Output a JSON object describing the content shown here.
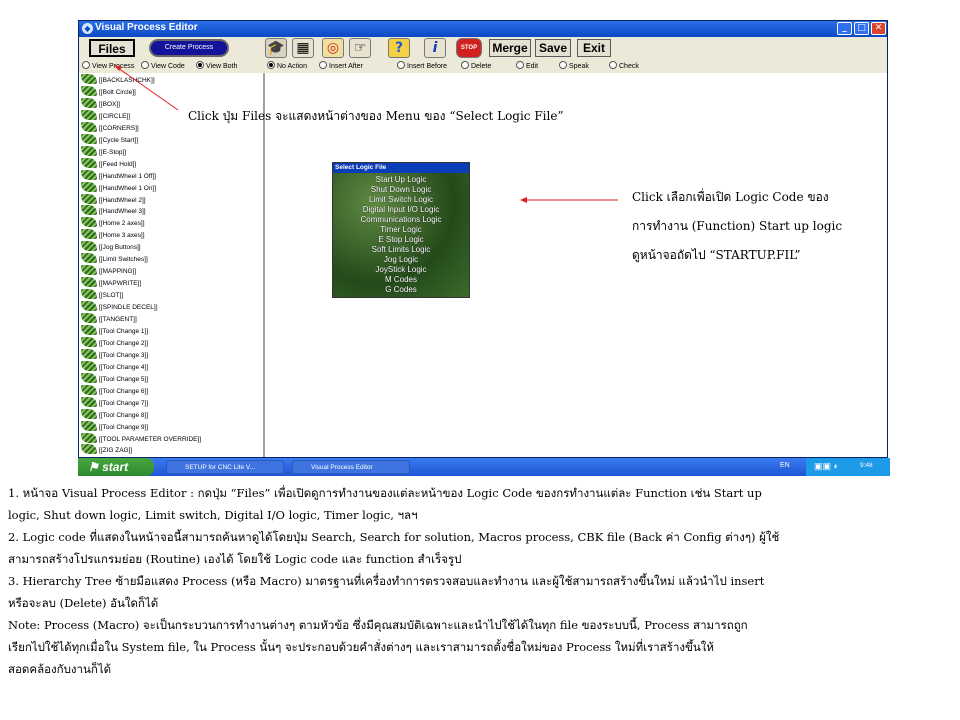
{
  "window": {
    "title": "Visual Process Editor",
    "controls": {
      "minimize": "_",
      "maximize": "□",
      "close": "✕"
    }
  },
  "toolbar": {
    "files": "Files",
    "create_process": "Create Process",
    "merge": "Merge",
    "save": "Save",
    "exit": "Exit",
    "icons": [
      "hat-icon",
      "grid-icon",
      "target-icon",
      "hand-icon",
      "help-icon",
      "info-icon",
      "stop-icon"
    ],
    "stop_label": "STOP"
  },
  "view_options": [
    "View Process",
    "View Code",
    "View Both"
  ],
  "view_selected": "View Both",
  "action_options": [
    "No Action",
    "Insert After",
    "Insert Before",
    "Delete",
    "Edit",
    "Speak",
    "Check"
  ],
  "action_selected": "No Action",
  "tree": {
    "items": [
      "[[BACKLASHCHK]]",
      "[[Bolt Circle]]",
      "[[BOX]]",
      "[[CIRCLE]]",
      "[[CORNERS]]",
      "[[Cycle Start]]",
      "[[E-Stop]]",
      "[[Feed Hold]]",
      "[[HandWheel 1 Off]]",
      "[[HandWheel 1 On]]",
      "[[HandWheel 2]]",
      "[[HandWheel 3]]",
      "[[Home 2 axes]]",
      "[[Home 3 axes]]",
      "[[Jog Buttons]]",
      "[[Limit Switches]]",
      "[[MAPPING]]",
      "[[MAPWRITE]]",
      "[[SLOT]]",
      "[[SPINDLE DECEL]]",
      "[[TANGENT]]",
      "[[Tool Change 1]]",
      "[[Tool Change 2]]",
      "[[Tool Change 3]]",
      "[[Tool Change 4]]",
      "[[Tool Change 5]]",
      "[[Tool Change 6]]",
      "[[Tool Change 7]]",
      "[[Tool Change 8]]",
      "[[Tool Change 9]]",
      "[[TOOL PARAMETER OVERRIDE]]",
      "[[ZIG ZAG]]"
    ]
  },
  "select_logic": {
    "title": "Select Logic File",
    "items": [
      "Start Up Logic",
      "Shut Down Logic",
      "Limit Switch Logic",
      "Digital Input I/O Logic",
      "Communications Logic",
      "Timer Logic",
      "E Stop Logic",
      "Soft Limits Logic",
      "Jog Logic",
      "JoyStick Logic",
      "M Codes",
      "G Codes"
    ]
  },
  "taskbar": {
    "start": "start",
    "tasks": [
      "SETUP for CNC Lite V...",
      "Visual Process Editor"
    ],
    "lang": "EN",
    "time": "9:48"
  },
  "annotations": {
    "files_note": "Click ปุ่ม Files จะแสดงหน้าต่างของ Menu ของ “Select Logic File”",
    "logic_note": [
      "Click เลือกเพื่อเปิด Logic Code ของ",
      "การทำงาน (Function) Start up logic",
      "ดูหน้าจอถัดไป “STARTUP.FIL”"
    ]
  },
  "caption": [
    "1. หน้าจอ Visual Process Editor : กดปุ่ม “Files” เพื่อเปิดดูการทำงานของแต่ละหน้าของ Logic Code ของกรทำงานแต่ละ Function เช่น Start up",
    "logic, Shut down logic, Limit switch, Digital I/O logic, Timer logic, ฯลฯ",
    "2. Logic code ที่แสดงในหน้าจอนี้สามารถค้นหาดูได้โดยปุ่ม Search, Search for solution, Macros process, CBK file (Back ค่า Config ต่างๆ) ผู้ใช้",
    "สามารถสร้างโปรแกรมย่อย (Routine) เองได้ โดยใช้ Logic code และ function สำเร็จรูป",
    "3. Hierarchy Tree ซ้ายมือแสดง Process (หรือ Macro) มาตรฐานที่เครื่องทำการตรวจสอบและทำงาน และผู้ใช้สามารถสร้างขึ้นใหม่ แล้วนำไป insert",
    "หรือจะลบ (Delete) อันใดก็ได้",
    "Note: Process (Macro) จะเป็นกระบวนการทำงานต่างๆ ตามหัวข้อ ซึ่งมีคุณสมบัติเฉพาะและนำไปใช้ได้ในทุก file ของระบบนี้, Process สามารถถูก",
    "เรียกไปใช้ได้ทุกเมื่อใน System file, ใน Process นั้นๆ จะประกอบด้วยคำสั่งต่างๆ และเราสามารถตั้งชื่อใหม่ของ Process ใหม่ที่เราสร้างขึ้นให้",
    "สอดคล้องกับงานก็ได้"
  ],
  "colors": {
    "titlebar": "#0b48c4",
    "taskbar": "#1f55d4",
    "start": "#2f8a2e",
    "arrow": "#e02020"
  }
}
